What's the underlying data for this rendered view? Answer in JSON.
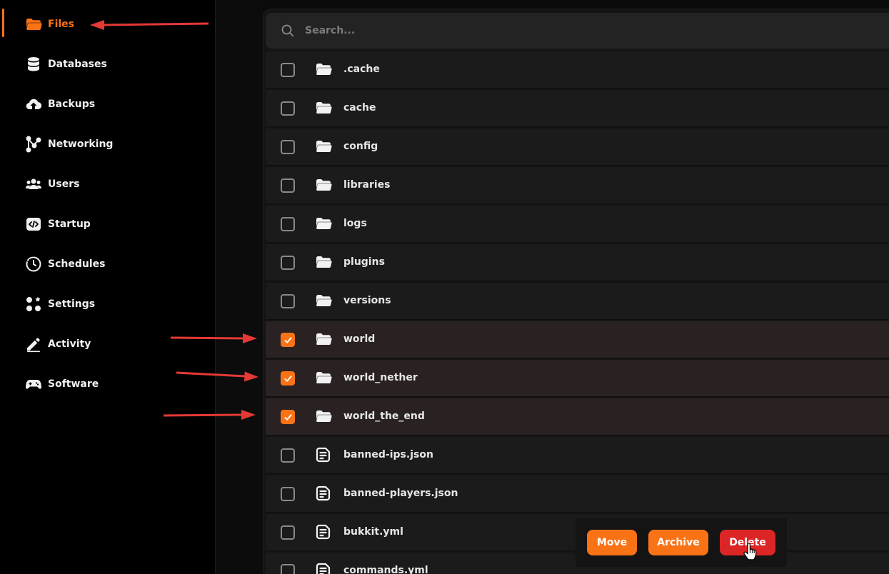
{
  "sidebar": {
    "items": [
      {
        "label": "Files",
        "icon": "folder-icon",
        "active": true
      },
      {
        "label": "Databases",
        "icon": "database-icon",
        "active": false
      },
      {
        "label": "Backups",
        "icon": "cloud-upload-icon",
        "active": false
      },
      {
        "label": "Networking",
        "icon": "network-icon",
        "active": false
      },
      {
        "label": "Users",
        "icon": "users-icon",
        "active": false
      },
      {
        "label": "Startup",
        "icon": "code-icon",
        "active": false
      },
      {
        "label": "Schedules",
        "icon": "clock-icon",
        "active": false
      },
      {
        "label": "Settings",
        "icon": "settings-grid-icon",
        "active": false
      },
      {
        "label": "Activity",
        "icon": "pencil-icon",
        "active": false
      },
      {
        "label": "Software",
        "icon": "gamepad-icon",
        "active": false
      }
    ]
  },
  "search": {
    "placeholder": "Search..."
  },
  "files": [
    {
      "name": ".cache",
      "type": "folder",
      "selected": false
    },
    {
      "name": "cache",
      "type": "folder",
      "selected": false
    },
    {
      "name": "config",
      "type": "folder",
      "selected": false
    },
    {
      "name": "libraries",
      "type": "folder",
      "selected": false
    },
    {
      "name": "logs",
      "type": "folder",
      "selected": false
    },
    {
      "name": "plugins",
      "type": "folder",
      "selected": false
    },
    {
      "name": "versions",
      "type": "folder",
      "selected": false
    },
    {
      "name": "world",
      "type": "folder",
      "selected": true
    },
    {
      "name": "world_nether",
      "type": "folder",
      "selected": true
    },
    {
      "name": "world_the_end",
      "type": "folder",
      "selected": true
    },
    {
      "name": "banned-ips.json",
      "type": "file",
      "selected": false
    },
    {
      "name": "banned-players.json",
      "type": "file",
      "selected": false
    },
    {
      "name": "bukkit.yml",
      "type": "file",
      "selected": false
    },
    {
      "name": "commands.yml",
      "type": "file",
      "selected": false
    }
  ],
  "actions": {
    "move": "Move",
    "archive": "Archive",
    "delete": "Delete"
  },
  "colors": {
    "accent": "#f97316",
    "danger": "#dc2626",
    "annotation": "#e53935"
  }
}
